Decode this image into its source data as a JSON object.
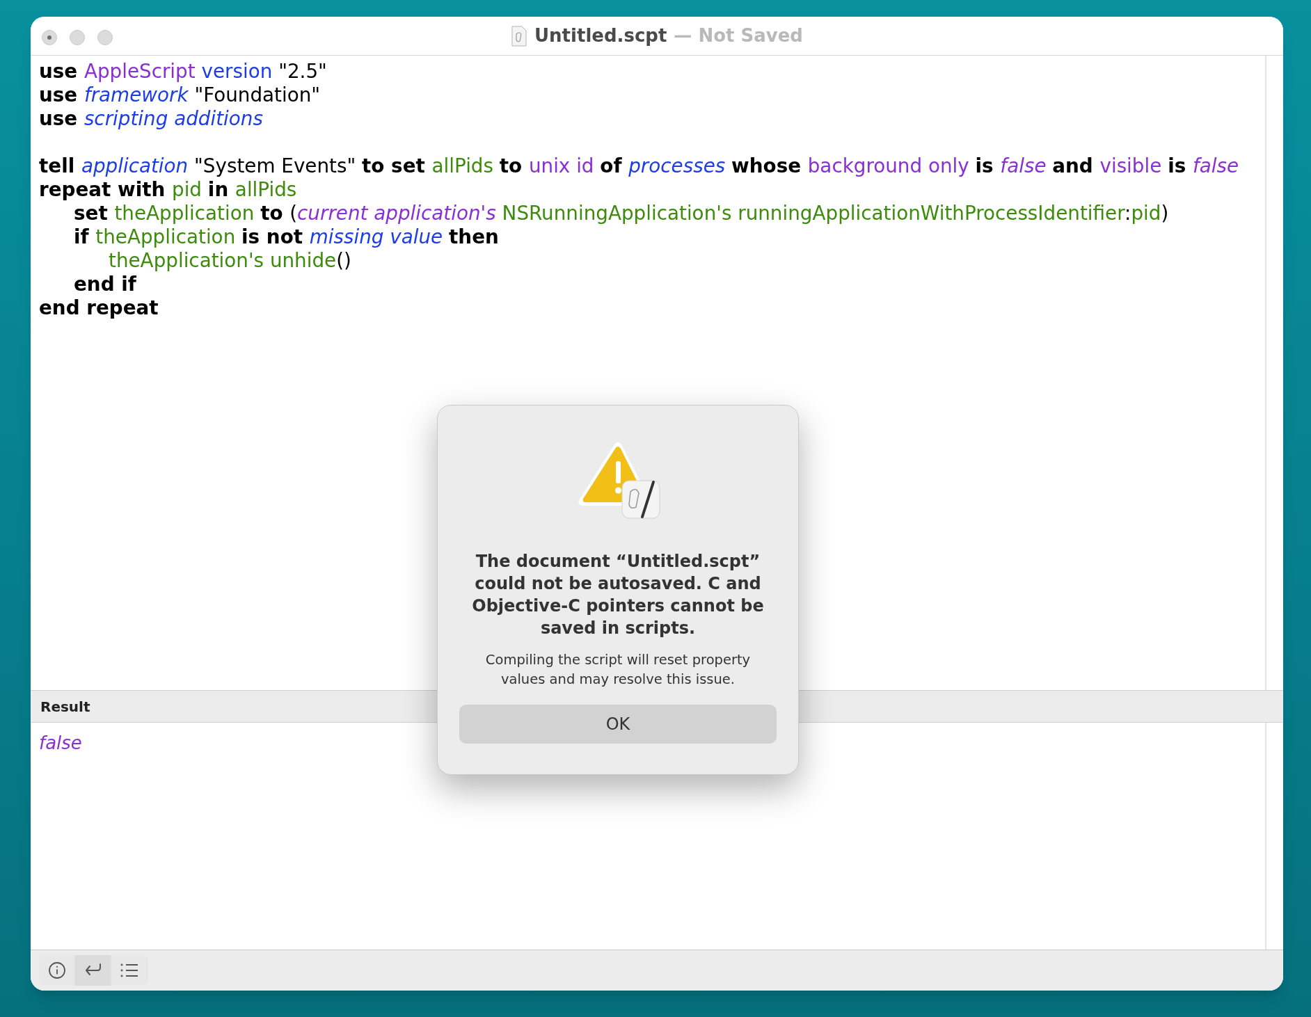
{
  "window": {
    "title": "Untitled.scpt",
    "status": "— Not Saved"
  },
  "editor": {
    "lines": [
      {
        "tokens": [
          {
            "t": "use ",
            "kind": "keyword"
          },
          {
            "t": "AppleScript ",
            "kind": "app"
          },
          {
            "t": "version ",
            "kind": "property"
          },
          {
            "t": "\"2.5\"",
            "kind": "text"
          }
        ]
      },
      {
        "tokens": [
          {
            "t": "use ",
            "kind": "keyword"
          },
          {
            "t": "framework ",
            "kind": "class"
          },
          {
            "t": "\"Foundation\"",
            "kind": "text"
          }
        ]
      },
      {
        "tokens": [
          {
            "t": "use ",
            "kind": "keyword"
          },
          {
            "t": "scripting additions",
            "kind": "class"
          }
        ]
      },
      {
        "kind": "blank"
      },
      {
        "tokens": [
          {
            "t": "tell ",
            "kind": "keyword"
          },
          {
            "t": "application ",
            "kind": "class"
          },
          {
            "t": "\"System Events\" ",
            "kind": "text"
          },
          {
            "t": "to set ",
            "kind": "keyword"
          },
          {
            "t": "allPids ",
            "kind": "variable"
          },
          {
            "t": "to ",
            "kind": "keyword"
          },
          {
            "t": "unix id ",
            "kind": "app"
          },
          {
            "t": "of ",
            "kind": "keyword"
          },
          {
            "t": "processes ",
            "kind": "class"
          },
          {
            "t": "whose ",
            "kind": "keyword"
          },
          {
            "t": "background only ",
            "kind": "app"
          },
          {
            "t": "is ",
            "kind": "keyword"
          },
          {
            "t": "false ",
            "kind": "constant"
          },
          {
            "t": "and ",
            "kind": "keyword"
          },
          {
            "t": "visible ",
            "kind": "app"
          },
          {
            "t": "is ",
            "kind": "keyword"
          },
          {
            "t": "false",
            "kind": "constant"
          }
        ]
      },
      {
        "tokens": [
          {
            "t": "repeat with ",
            "kind": "keyword"
          },
          {
            "t": "pid ",
            "kind": "variable"
          },
          {
            "t": "in ",
            "kind": "keyword"
          },
          {
            "t": "allPids",
            "kind": "variable"
          }
        ],
        "children": [
          {
            "tokens": [
              {
                "t": "set ",
                "kind": "keyword"
              },
              {
                "t": "theApplication ",
                "kind": "variable"
              },
              {
                "t": "to ",
                "kind": "keyword"
              },
              {
                "t": "(",
                "kind": "text"
              },
              {
                "t": "current application's ",
                "kind": "constant"
              },
              {
                "t": "NSRunningApplication's runningApplicationWithProcessIdentifier",
                "kind": "variable"
              },
              {
                "t": ":",
                "kind": "text"
              },
              {
                "t": "pid",
                "kind": "variable"
              },
              {
                "t": ")",
                "kind": "text"
              }
            ]
          },
          {
            "tokens": [
              {
                "t": "if ",
                "kind": "keyword"
              },
              {
                "t": "theApplication ",
                "kind": "variable"
              },
              {
                "t": "is not ",
                "kind": "keyword"
              },
              {
                "t": "missing value ",
                "kind": "class"
              },
              {
                "t": "then",
                "kind": "keyword"
              }
            ],
            "children": [
              {
                "tokens": [
                  {
                    "t": "theApplication's unhide",
                    "kind": "variable"
                  },
                  {
                    "t": "()",
                    "kind": "text"
                  }
                ]
              }
            ]
          },
          {
            "tokens": [
              {
                "t": "end if",
                "kind": "keyword"
              }
            ]
          }
        ]
      },
      {
        "tokens": [
          {
            "t": "end repeat",
            "kind": "keyword"
          }
        ]
      }
    ]
  },
  "result": {
    "header": "Result",
    "tokens": [
      {
        "t": "false",
        "kind": "constant"
      }
    ]
  },
  "toolbar": [
    {
      "kind": "info",
      "selected": false
    },
    {
      "kind": "return",
      "selected": true
    },
    {
      "kind": "list",
      "selected": false
    }
  ],
  "dialog": {
    "title": "The document “Untitled.scpt” could not be autosaved. C and Objective-C pointers cannot be saved in scripts.",
    "message": "Compiling the script will reset property values and may resolve this issue.",
    "button": "OK"
  }
}
